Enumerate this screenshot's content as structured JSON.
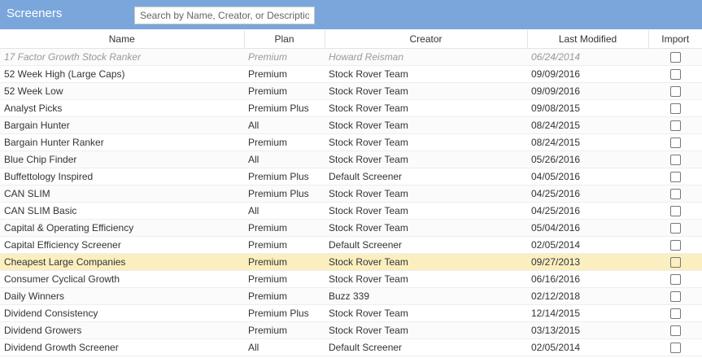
{
  "header": {
    "title": "Screeners",
    "search_placeholder": "Search by Name, Creator, or Description"
  },
  "columns": [
    "Name",
    "Plan",
    "Creator",
    "Last Modified",
    "Import"
  ],
  "rows": [
    {
      "name": "17 Factor Growth Stock Ranker",
      "plan": "Premium",
      "creator": "Howard Reisman",
      "modified": "06/24/2014",
      "system": true
    },
    {
      "name": "52 Week High (Large Caps)",
      "plan": "Premium",
      "creator": "Stock Rover Team",
      "modified": "09/09/2016"
    },
    {
      "name": "52 Week Low",
      "plan": "Premium",
      "creator": "Stock Rover Team",
      "modified": "09/09/2016"
    },
    {
      "name": "Analyst Picks",
      "plan": "Premium Plus",
      "creator": "Stock Rover Team",
      "modified": "09/08/2015"
    },
    {
      "name": "Bargain Hunter",
      "plan": "All",
      "creator": "Stock Rover Team",
      "modified": "08/24/2015"
    },
    {
      "name": "Bargain Hunter Ranker",
      "plan": "Premium",
      "creator": "Stock Rover Team",
      "modified": "08/24/2015"
    },
    {
      "name": "Blue Chip Finder",
      "plan": "All",
      "creator": "Stock Rover Team",
      "modified": "05/26/2016"
    },
    {
      "name": "Buffettology Inspired",
      "plan": "Premium Plus",
      "creator": "Default Screener",
      "modified": "04/05/2016"
    },
    {
      "name": "CAN SLIM",
      "plan": "Premium Plus",
      "creator": "Stock Rover Team",
      "modified": "04/25/2016"
    },
    {
      "name": "CAN SLIM Basic",
      "plan": "All",
      "creator": "Stock Rover Team",
      "modified": "04/25/2016"
    },
    {
      "name": "Capital & Operating Efficiency",
      "plan": "Premium",
      "creator": "Stock Rover Team",
      "modified": "05/04/2016"
    },
    {
      "name": "Capital Efficiency Screener",
      "plan": "Premium",
      "creator": "Default Screener",
      "modified": "02/05/2014"
    },
    {
      "name": "Cheapest Large Companies",
      "plan": "Premium",
      "creator": "Stock Rover Team",
      "modified": "09/27/2013",
      "selected": true
    },
    {
      "name": "Consumer Cyclical Growth",
      "plan": "Premium",
      "creator": "Stock Rover Team",
      "modified": "06/16/2016"
    },
    {
      "name": "Daily Winners",
      "plan": "Premium",
      "creator": "Buzz 339",
      "modified": "02/12/2018"
    },
    {
      "name": "Dividend Consistency",
      "plan": "Premium Plus",
      "creator": "Stock Rover Team",
      "modified": "12/14/2015"
    },
    {
      "name": "Dividend Growers",
      "plan": "Premium",
      "creator": "Stock Rover Team",
      "modified": "03/13/2015"
    },
    {
      "name": "Dividend Growth Screener",
      "plan": "All",
      "creator": "Default Screener",
      "modified": "02/05/2014"
    }
  ],
  "colors": {
    "header_bg": "#7aa6db",
    "selected_row": "#fbefc0",
    "system_text": "#999999"
  }
}
